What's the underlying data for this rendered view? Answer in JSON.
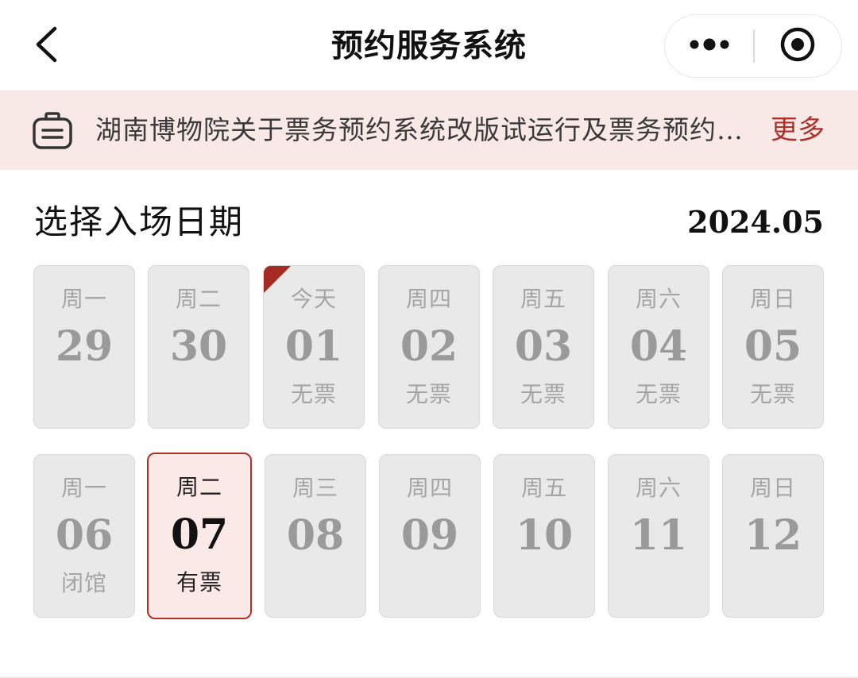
{
  "navbar": {
    "title": "预约服务系统",
    "back_icon": "chevron-left-icon",
    "more_icon": "more-dots-icon",
    "close_icon": "target-close-icon"
  },
  "notice": {
    "icon": "notice-board-icon",
    "text": "湖南博物院关于票务预约系统改版试运行及票务预约…",
    "more_label": "更多",
    "more_color": "#b0302a",
    "background": "#f8e8e6"
  },
  "section": {
    "title": "选择入场日期",
    "month": "2024.05"
  },
  "days": [
    {
      "weekday": "周一",
      "day": "29",
      "status": "",
      "state": "disabled"
    },
    {
      "weekday": "周二",
      "day": "30",
      "status": "",
      "state": "disabled"
    },
    {
      "weekday": "今天",
      "day": "01",
      "status": "无票",
      "state": "disabled",
      "today": true
    },
    {
      "weekday": "周四",
      "day": "02",
      "status": "无票",
      "state": "disabled"
    },
    {
      "weekday": "周五",
      "day": "03",
      "status": "无票",
      "state": "disabled"
    },
    {
      "weekday": "周六",
      "day": "04",
      "status": "无票",
      "state": "disabled"
    },
    {
      "weekday": "周日",
      "day": "05",
      "status": "无票",
      "state": "disabled"
    },
    {
      "weekday": "周一",
      "day": "06",
      "status": "闭馆",
      "state": "disabled"
    },
    {
      "weekday": "周二",
      "day": "07",
      "status": "有票",
      "state": "selected"
    },
    {
      "weekday": "周三",
      "day": "08",
      "status": "",
      "state": "disabled"
    },
    {
      "weekday": "周四",
      "day": "09",
      "status": "",
      "state": "disabled"
    },
    {
      "weekday": "周五",
      "day": "10",
      "status": "",
      "state": "disabled"
    },
    {
      "weekday": "周六",
      "day": "11",
      "status": "",
      "state": "disabled"
    },
    {
      "weekday": "周日",
      "day": "12",
      "status": "",
      "state": "disabled"
    }
  ],
  "colors": {
    "accent": "#b0302a",
    "card_disabled": "#e9e9e9",
    "card_selected": "#fbe9e7",
    "today_corner": "#a52a24"
  }
}
